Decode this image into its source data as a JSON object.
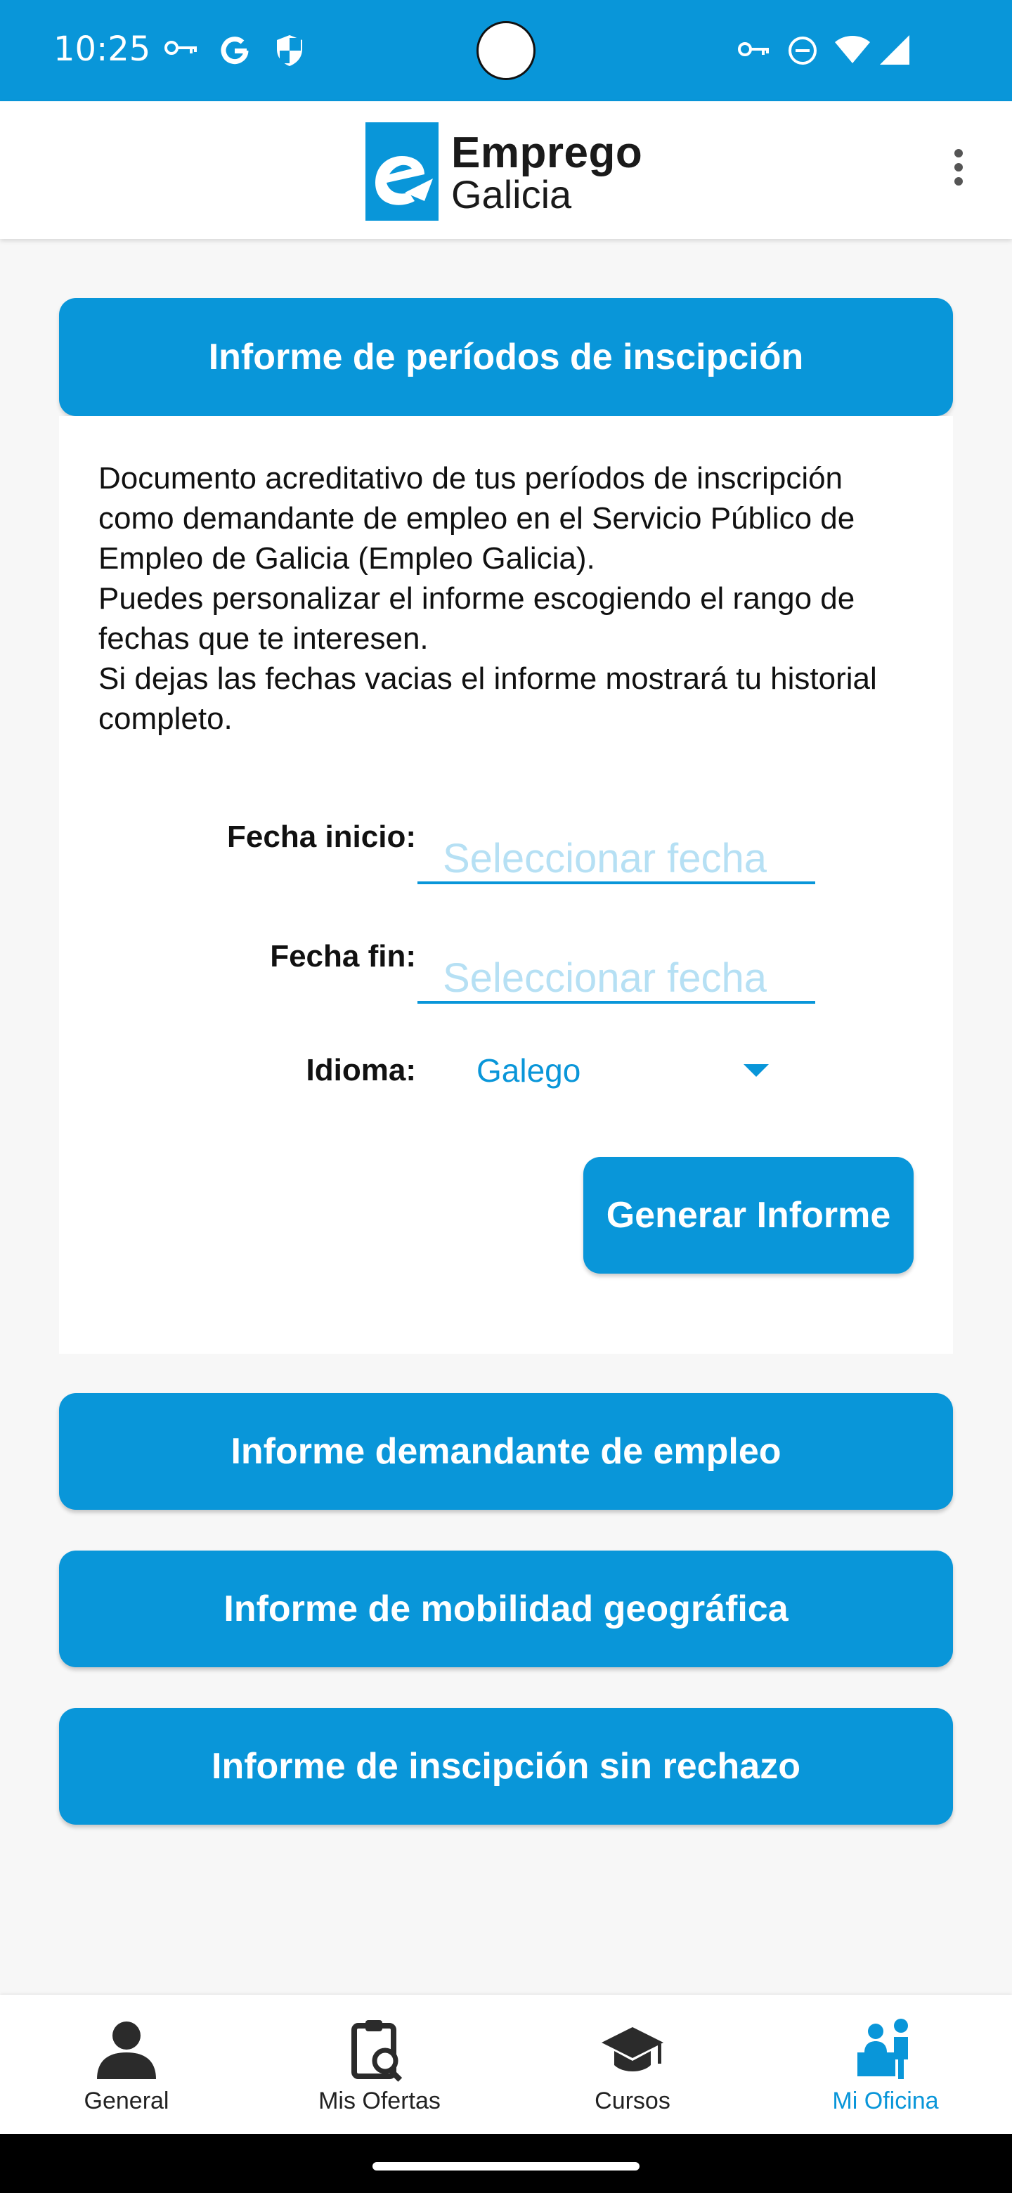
{
  "status_bar": {
    "time": "10:25"
  },
  "app_bar": {
    "brand_line1": "Emprego",
    "brand_line2": "Galicia"
  },
  "card": {
    "title": "Informe de períodos de inscipción",
    "description": [
      "Documento acreditativo de tus períodos de inscripción como demandante de empleo en el Servicio Público de Empleo de Galicia (Empleo Galicia).",
      "Puedes personalizar el informe escogiendo el rango de fechas que te interesen.",
      "Si dejas las fechas vacias el informe mostrará tu historial completo."
    ],
    "start_label": "Fecha inicio:",
    "start_placeholder": "Seleccionar fecha",
    "end_label": "Fecha fin:",
    "end_placeholder": "Seleccionar fecha",
    "language_label": "Idioma:",
    "language_value": "Galego",
    "generate_button": "Generar Informe"
  },
  "reports": [
    "Informe demandante de empleo",
    "Informe de mobilidad geográfica",
    "Informe de inscipción sin rechazo"
  ],
  "bottom_nav": [
    {
      "label": "General",
      "icon": "person-icon",
      "active": false
    },
    {
      "label": "Mis Ofertas",
      "icon": "clipboard-search-icon",
      "active": false
    },
    {
      "label": "Cursos",
      "icon": "graduation-cap-icon",
      "active": false
    },
    {
      "label": "Mi Oficina",
      "icon": "office-desk-icon",
      "active": true
    }
  ],
  "colors": {
    "accent": "#0996d9",
    "placeholder": "#b6e0f4"
  }
}
